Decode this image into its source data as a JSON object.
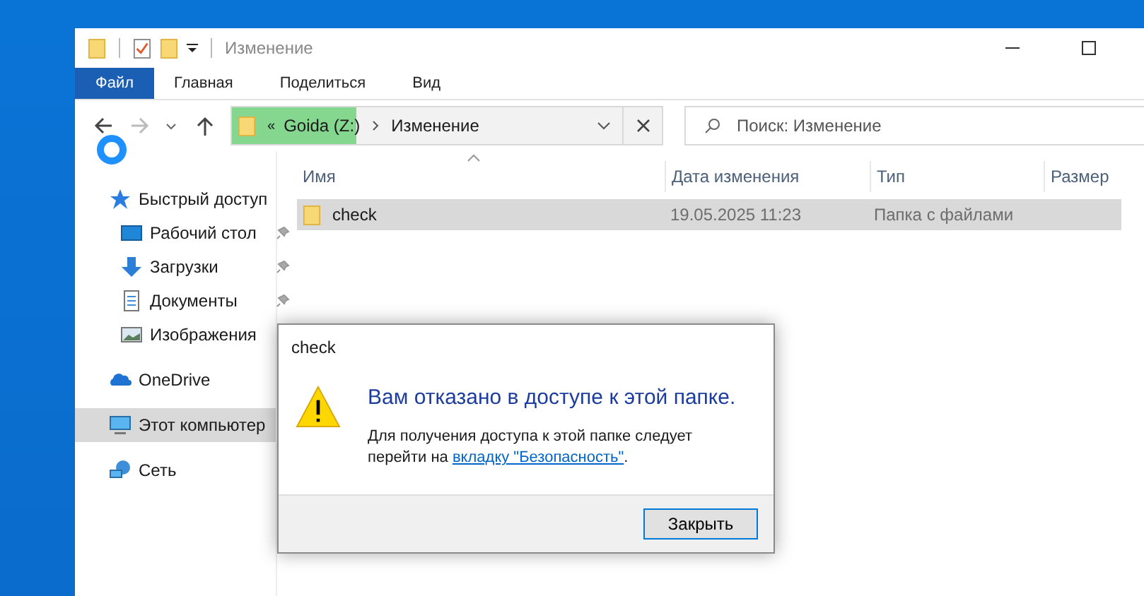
{
  "window": {
    "title": "Изменение"
  },
  "ribbon_tabs": [
    {
      "label": "Файл",
      "selected": true
    },
    {
      "label": "Главная",
      "selected": false
    },
    {
      "label": "Поделиться",
      "selected": false
    },
    {
      "label": "Вид",
      "selected": false
    }
  ],
  "address": {
    "overflow": "«",
    "segments": [
      "Goida (Z:)",
      "Изменение"
    ],
    "level": 0.32
  },
  "search": {
    "placeholder": "Поиск: Изменение"
  },
  "sidebar": {
    "items": [
      {
        "label": "Быстрый доступ",
        "kind": "star",
        "selected": false,
        "children": [
          {
            "label": "Рабочий стол",
            "kind": "desktop",
            "pinned": true,
            "selected": false
          },
          {
            "label": "Загрузки",
            "kind": "download",
            "pinned": true,
            "selected": false
          },
          {
            "label": "Документы",
            "kind": "document",
            "pinned": true,
            "selected": false
          },
          {
            "label": "Изображения",
            "kind": "image",
            "pinned": false,
            "selected": false
          }
        ]
      },
      {
        "label": "OneDrive",
        "kind": "cloud",
        "selected": false
      },
      {
        "label": "Этот компьютер",
        "kind": "computer",
        "selected": true
      },
      {
        "label": "Сеть",
        "kind": "network",
        "selected": false
      }
    ]
  },
  "table": {
    "columns": [
      "Имя",
      "Дата изменения",
      "Тип",
      "Размер"
    ],
    "rows": [
      {
        "name": "check",
        "date": "19.05.2025 11:23",
        "type": "Папка с файлами",
        "selected": true
      }
    ]
  },
  "dialog": {
    "title": "check",
    "heading": "Вам отказано в доступе к этой папке.",
    "message": "Для получения доступа к этой папке следует перейти на ",
    "link": "вкладку \"Безопасность\"",
    "message_end": ".",
    "buttons": [
      "Закрыть"
    ]
  }
}
